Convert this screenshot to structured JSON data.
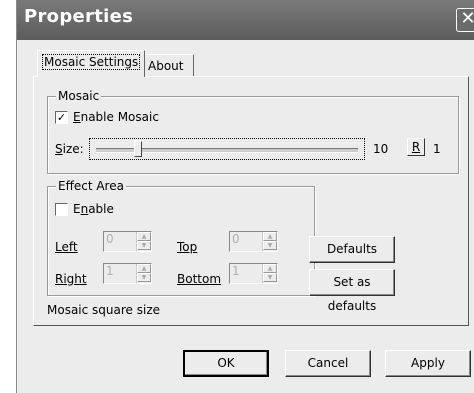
{
  "window": {
    "title": "Properties",
    "close_glyph": "✕"
  },
  "tabs": [
    {
      "label": "Mosaic Settings",
      "active": true
    },
    {
      "label": "About",
      "active": false
    }
  ],
  "mosaic_group": {
    "title": "Mosaic",
    "enable_checkbox": {
      "label": "Enable Mosaic",
      "mnemonic": "E",
      "checked": true,
      "glyph": "✓"
    },
    "size": {
      "label": "Size:",
      "mnemonic": "S",
      "slider_value": 10,
      "value_text": "10",
      "reset_button": "R",
      "secondary_value": "1"
    }
  },
  "effect_area_group": {
    "title": "Effect Area",
    "enable_checkbox": {
      "label": "Enable",
      "mnemonic": "n",
      "checked": false
    },
    "left": {
      "label": "Left",
      "value": "0"
    },
    "top": {
      "label": "Top",
      "value": "0"
    },
    "right": {
      "label": "Right",
      "value": "1"
    },
    "bottom": {
      "label": "Bottom",
      "value": "1"
    }
  },
  "buttons": {
    "defaults": "Defaults",
    "set_as_defaults": "Set as defaults",
    "ok": "OK",
    "cancel": "Cancel",
    "apply": "Apply"
  },
  "status_text": "Mosaic square size"
}
